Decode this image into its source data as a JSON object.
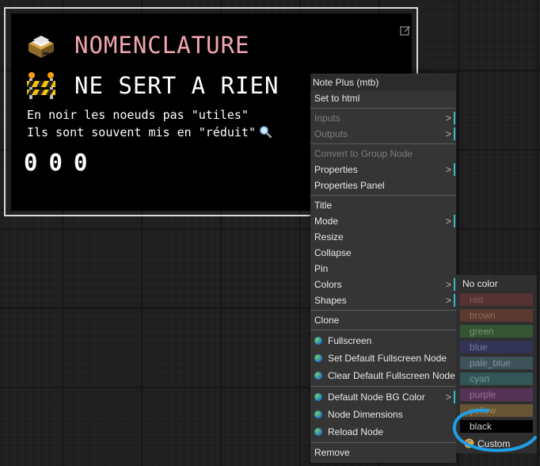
{
  "node": {
    "heading1": "NOMENCLATURE",
    "heading1_icon": "card-file-box-icon",
    "heading2": "NE SERT A RIEN",
    "heading2_icon": "construction-barrier-icon",
    "line1": "En noir les noeuds pas \"utiles\"",
    "line2": "Ils sont souvent mis en \"réduit\"",
    "line2_icon": "magnifying-glass-icon",
    "counters": [
      "0",
      "0",
      "0"
    ],
    "edit_icon": "edit-icon"
  },
  "context_menu": {
    "title": "Note Plus (mtb)",
    "items": [
      {
        "label": "Set to html"
      },
      {
        "label": "Inputs"
      },
      {
        "label": "Outputs"
      },
      {
        "label": "Convert to Group Node"
      },
      {
        "label": "Properties"
      },
      {
        "label": "Properties Panel"
      },
      {
        "label": "Title"
      },
      {
        "label": "Mode"
      },
      {
        "label": "Resize"
      },
      {
        "label": "Collapse"
      },
      {
        "label": "Pin"
      },
      {
        "label": "Colors"
      },
      {
        "label": "Shapes"
      },
      {
        "label": "Clone"
      },
      {
        "label": "Fullscreen"
      },
      {
        "label": "Set Default Fullscreen Node"
      },
      {
        "label": "Clear Default Fullscreen Node"
      },
      {
        "label": "Default Node BG Color"
      },
      {
        "label": "Node Dimensions"
      },
      {
        "label": "Reload Node"
      },
      {
        "label": "Remove"
      }
    ],
    "submenu_arrow": ">"
  },
  "colors_submenu": {
    "title": "No color",
    "options": [
      {
        "label": "red",
        "color": "#553333"
      },
      {
        "label": "brown",
        "color": "#593930"
      },
      {
        "label": "green",
        "color": "#335533"
      },
      {
        "label": "blue",
        "color": "#333355"
      },
      {
        "label": "pale_blue",
        "color": "#3f5159"
      },
      {
        "label": "cyan",
        "color": "#335555"
      },
      {
        "label": "purple",
        "color": "#553355"
      },
      {
        "label": "yellow",
        "color": "#665533"
      },
      {
        "label": "black",
        "color": "#000000"
      }
    ],
    "custom_label": "Custom",
    "custom_icon": "palette-icon"
  },
  "colors": {
    "accent_teal": "#3bb6c4",
    "annotation_circle": "#1e9ee6",
    "heading_pink": "#f4a6b0"
  }
}
